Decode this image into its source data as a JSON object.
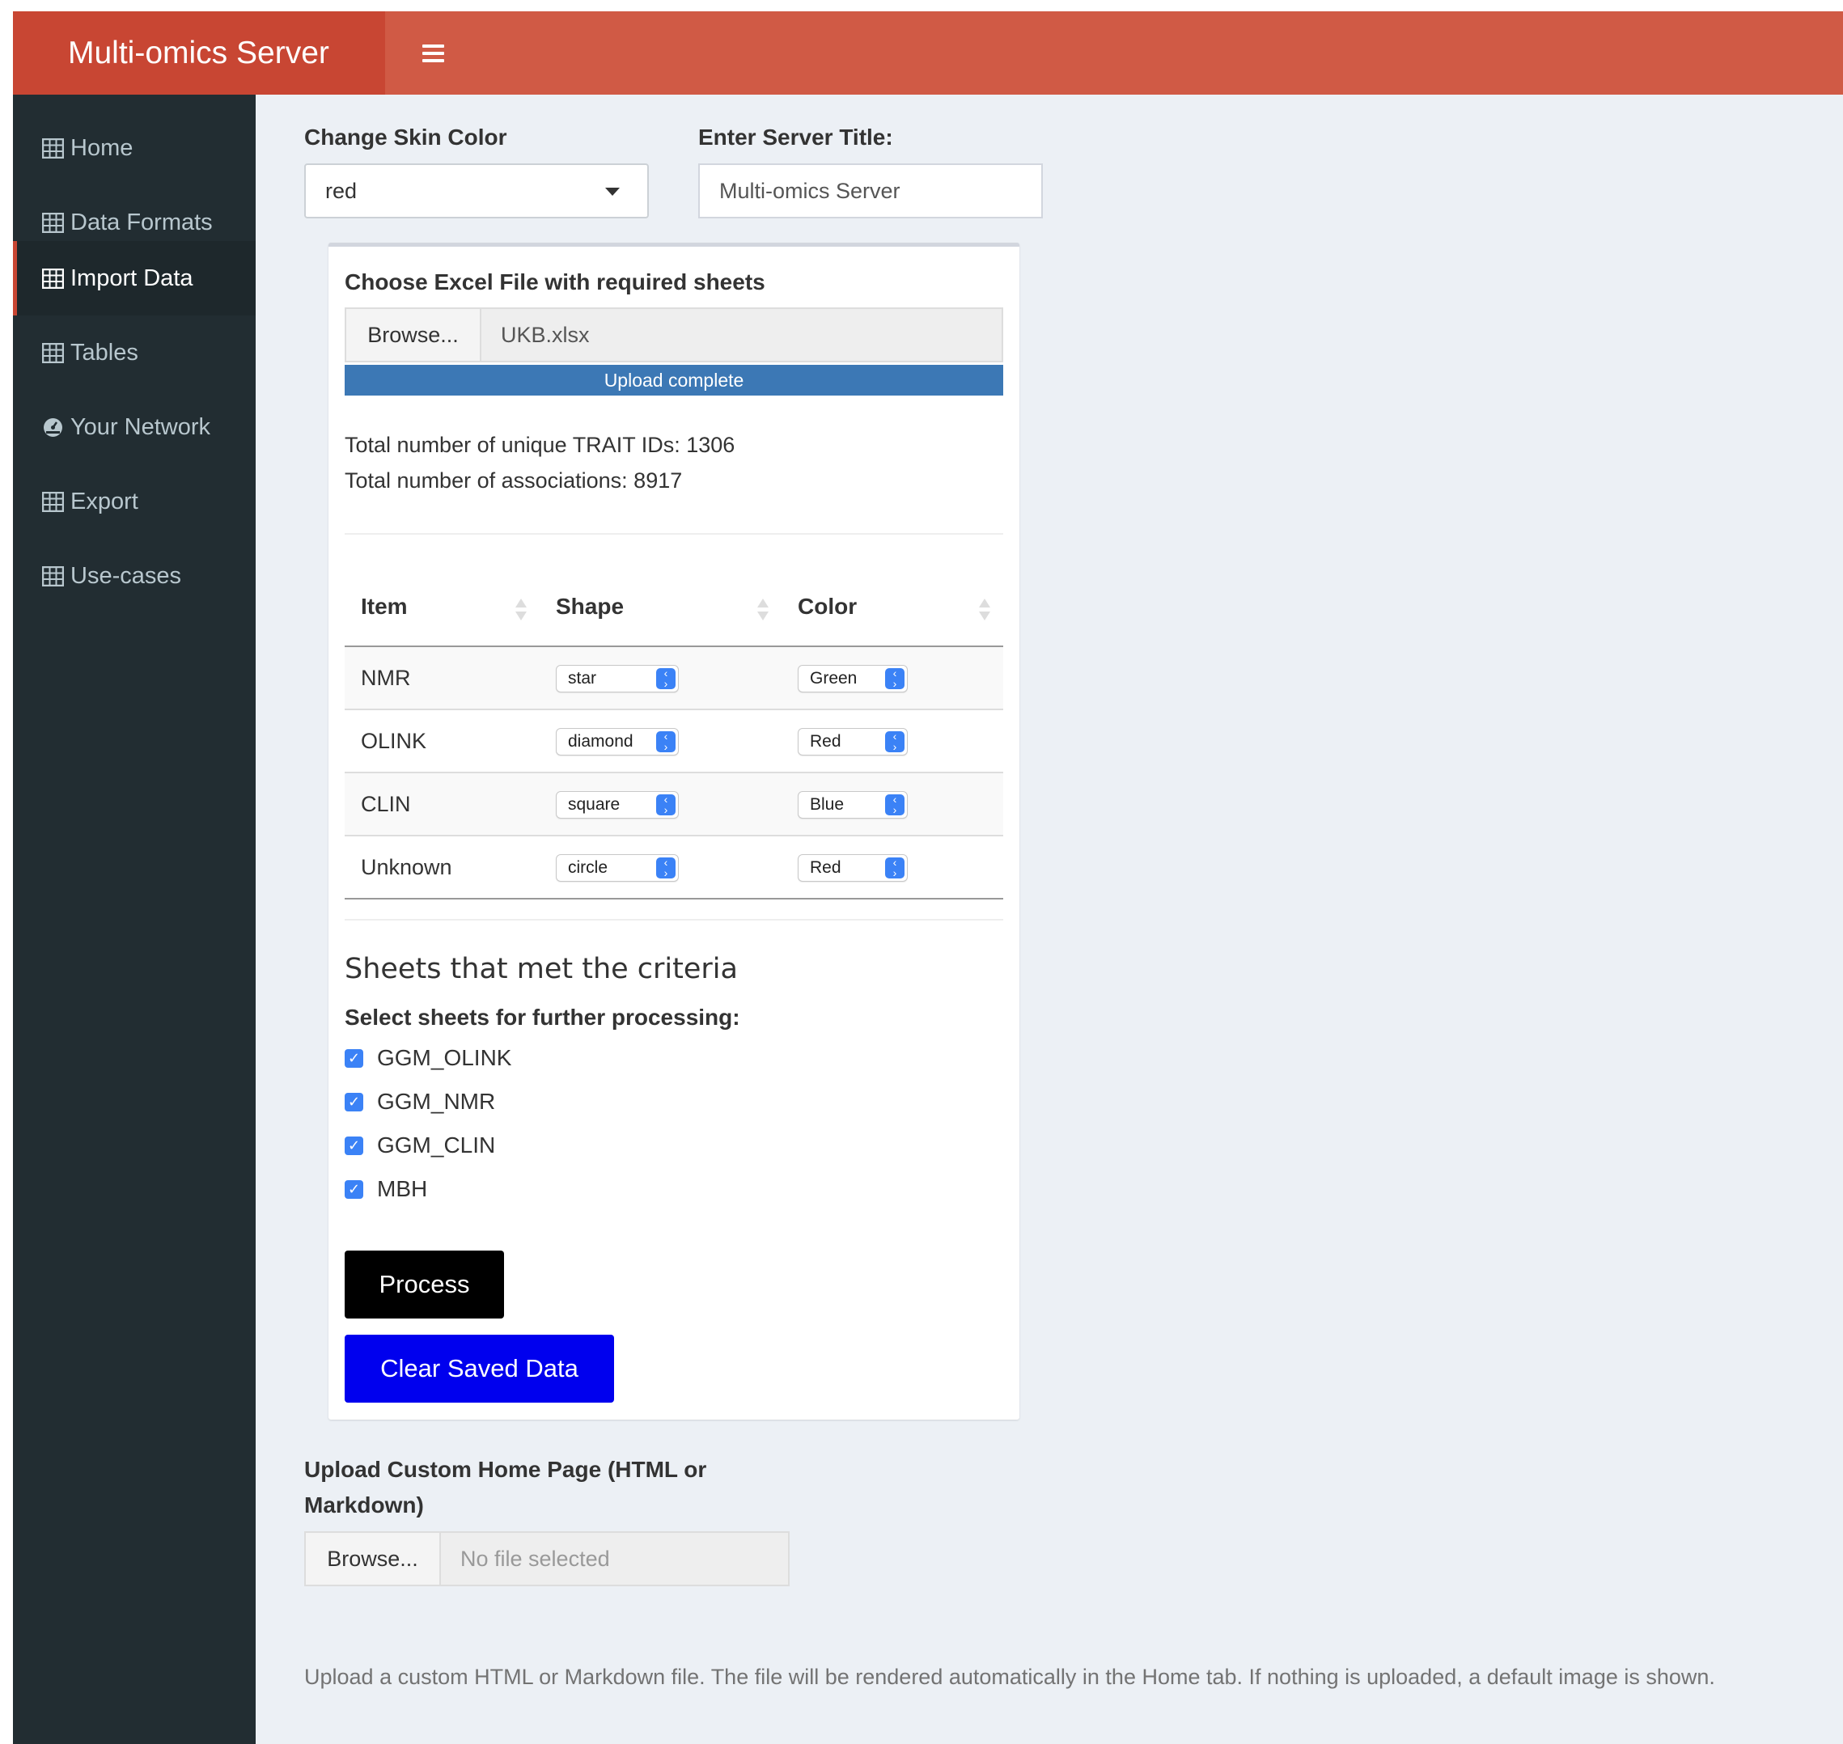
{
  "header": {
    "app_title": "Multi-omics Server"
  },
  "sidebar": {
    "items": [
      {
        "label": "Home",
        "icon": "table-icon"
      },
      {
        "label": "Data Formats",
        "icon": "table-icon"
      },
      {
        "label": "Import Data",
        "icon": "table-icon",
        "active": true
      },
      {
        "label": "Tables",
        "icon": "table-icon"
      },
      {
        "label": "Your Network",
        "icon": "dashboard-icon"
      },
      {
        "label": "Export",
        "icon": "table-icon"
      },
      {
        "label": "Use-cases",
        "icon": "table-icon"
      }
    ]
  },
  "settings": {
    "skin_label": "Change Skin Color",
    "skin_value": "red",
    "title_label": "Enter Server Title:",
    "title_value": "Multi-omics Server"
  },
  "import_box": {
    "file_label": "Choose Excel File with required sheets",
    "browse_label": "Browse...",
    "file_name": "UKB.xlsx",
    "progress_text": "Upload complete",
    "progress_percent": 100,
    "stat_traits": "Total number of unique TRAIT IDs: 1306",
    "stat_assoc": "Total number of associations: 8917",
    "table": {
      "headers": [
        "Item",
        "Shape",
        "Color"
      ],
      "rows": [
        {
          "item": "NMR",
          "shape": "star",
          "color": "Green"
        },
        {
          "item": "OLINK",
          "shape": "diamond",
          "color": "Red"
        },
        {
          "item": "CLIN",
          "shape": "square",
          "color": "Blue"
        },
        {
          "item": "Unknown",
          "shape": "circle",
          "color": "Red"
        }
      ]
    },
    "sheets_title": "Sheets that met the criteria",
    "sheets_label": "Select sheets for further processing:",
    "sheets": [
      {
        "label": "GGM_OLINK",
        "checked": true
      },
      {
        "label": "GGM_NMR",
        "checked": true
      },
      {
        "label": "GGM_CLIN",
        "checked": true
      },
      {
        "label": "MBH",
        "checked": true
      }
    ],
    "process_label": "Process",
    "clear_label": "Clear Saved Data"
  },
  "custom_home": {
    "label_line1": "Upload Custom Home Page (HTML or",
    "label_line2": "Markdown)",
    "browse_label": "Browse...",
    "placeholder": "No file selected",
    "help_text": "Upload a custom HTML or Markdown file. The file will be rendered automatically in the Home tab. If nothing is uploaded, a default image is shown."
  },
  "colors": {
    "header": "#d05a45",
    "logo": "#c84633",
    "sidebar": "#222d32",
    "progress": "#3c78b5",
    "process_button": "#000000",
    "clear_button": "#0000ee"
  }
}
